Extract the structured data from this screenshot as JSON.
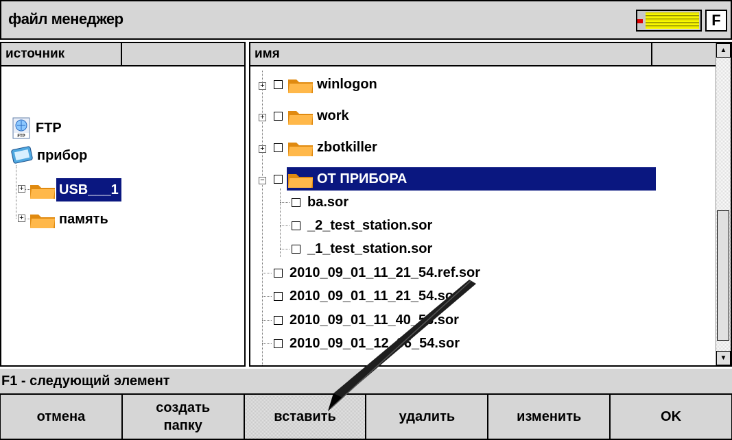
{
  "window": {
    "title": "файл менеджер",
    "f_key": "F"
  },
  "left_pane": {
    "header": "источник",
    "items": [
      {
        "label": "FTP",
        "icon": "ftp-icon"
      },
      {
        "label": "прибор",
        "icon": "device-icon"
      },
      {
        "label": "USB___1",
        "icon": "folder-icon",
        "selected": true
      },
      {
        "label": "память",
        "icon": "folder-icon"
      }
    ]
  },
  "right_pane": {
    "header": "имя",
    "folders": [
      {
        "label": "winlogon"
      },
      {
        "label": "work"
      },
      {
        "label": "zbotkiller"
      },
      {
        "label": "ОТ ПРИБОРА",
        "selected": true
      }
    ],
    "children": [
      {
        "label": "ba.sor"
      },
      {
        "label": "_2_test_station.sor"
      },
      {
        "label": "_1_test_station.sor"
      }
    ],
    "files": [
      {
        "label": "2010_09_01_11_21_54.ref.sor"
      },
      {
        "label": "2010_09_01_11_21_54.sor"
      },
      {
        "label": "2010_09_01_11_40_56.sor"
      },
      {
        "label": "2010_09_01_12_06_54.sor"
      }
    ]
  },
  "status": "F1 - следующий элемент",
  "buttons": [
    "отмена",
    "создать\nпапку",
    "вставить",
    "удалить",
    "изменить",
    "OK"
  ],
  "colors": {
    "selection": "#0a1780",
    "chrome": "#d6d6d6",
    "folder": "#f5a623"
  }
}
